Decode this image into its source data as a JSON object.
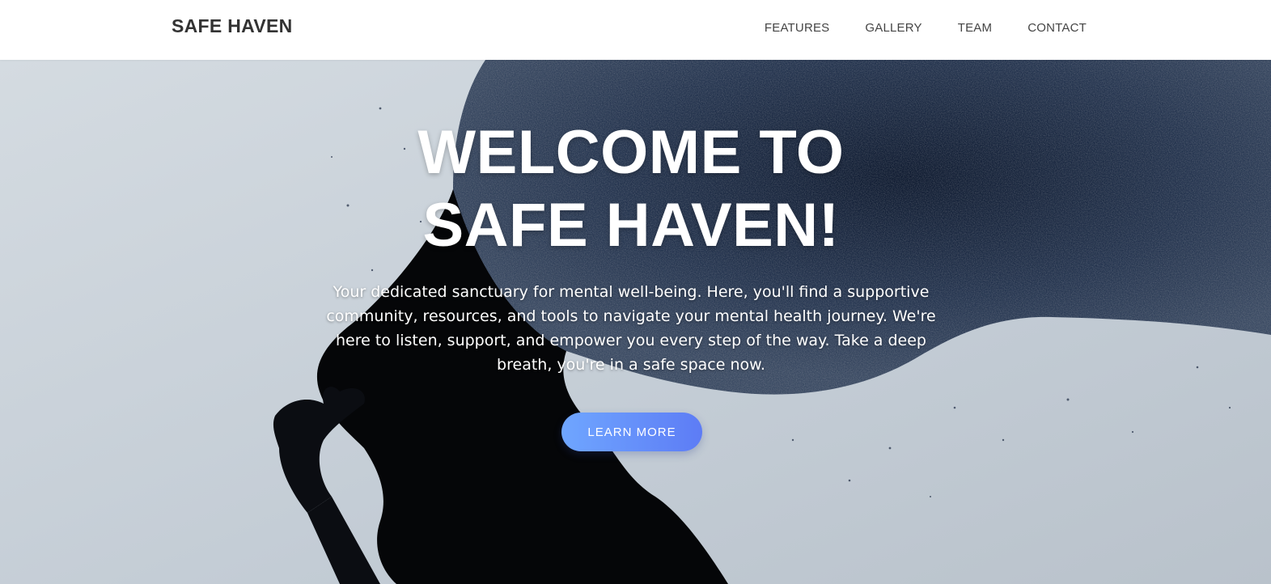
{
  "header": {
    "brand": "SAFE HAVEN",
    "nav": [
      "FEATURES",
      "GALLERY",
      "TEAM",
      "CONTACT"
    ]
  },
  "hero": {
    "title_line1": "WELCOME TO",
    "title_line2": "SAFE HAVEN!",
    "description": "Your dedicated sanctuary for mental well-being. Here, you'll find a supportive community, resources, and tools to navigate your mental health journey. We're here to listen, support, and empower you every step of the way. Take a deep breath, you're in a safe space now.",
    "cta_label": "LEARN MORE"
  },
  "colors": {
    "brand_text": "#333333",
    "nav_text": "#444444",
    "cta_gradient_start": "#6fa6ff",
    "cta_gradient_end": "#5d7cf5",
    "hero_sky": "#c7d0d8",
    "hero_ink": "#1c2a45"
  },
  "icons": {
    "hero_image": "silhouette-with-dispersing-hair-image"
  }
}
